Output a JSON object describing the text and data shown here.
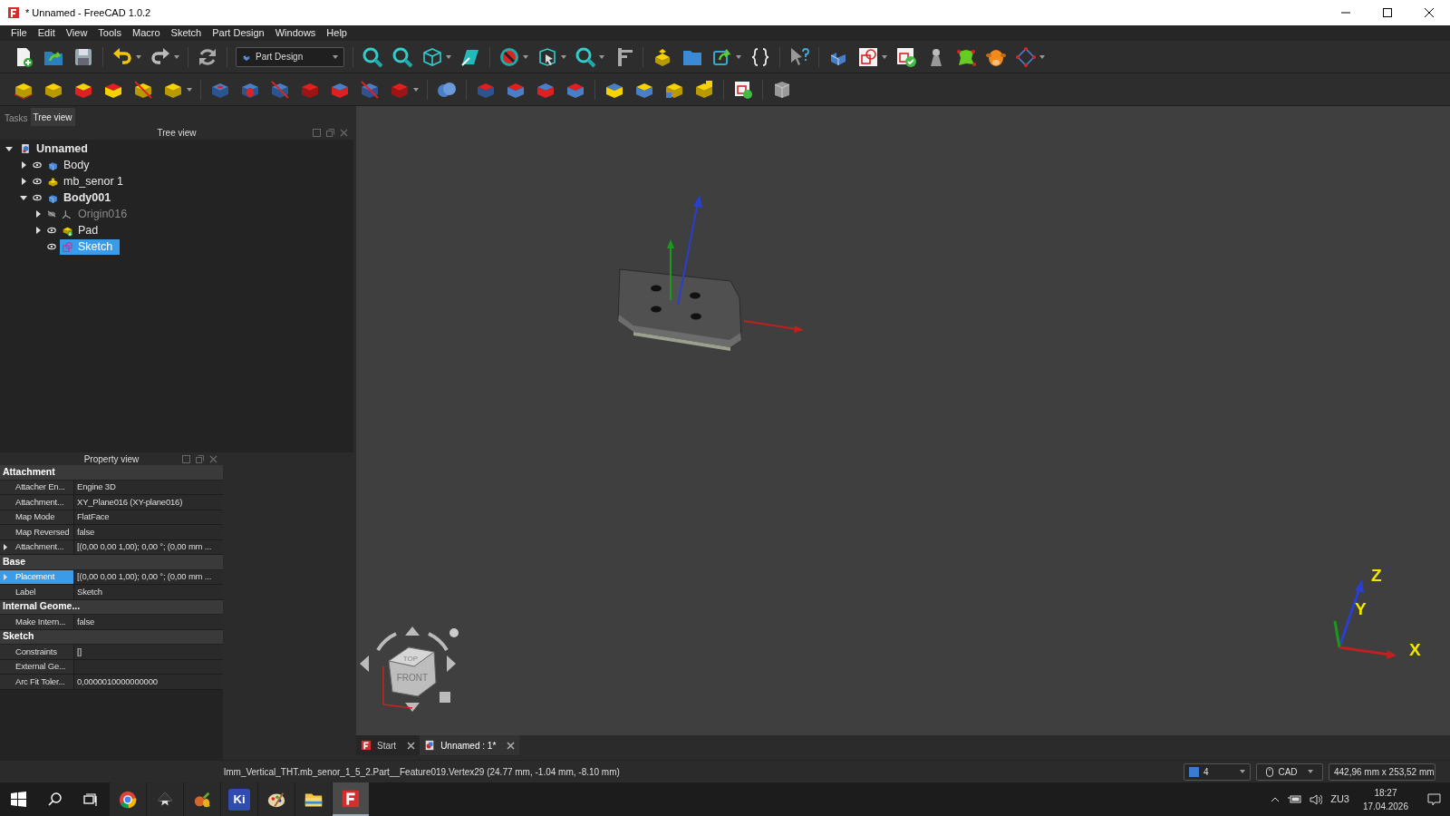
{
  "window": {
    "title": "* Unnamed - FreeCAD 1.0.2"
  },
  "menu": [
    "File",
    "Edit",
    "View",
    "Tools",
    "Macro",
    "Sketch",
    "Part Design",
    "Windows",
    "Help"
  ],
  "workbench": {
    "label": "Part Design"
  },
  "panel_tabs": [
    {
      "label": "Tasks",
      "selected": false
    },
    {
      "label": "Tree view",
      "selected": true
    }
  ],
  "tree": {
    "title": "Tree view",
    "items": [
      {
        "label": "Unnamed",
        "kind": "document",
        "active": true,
        "expanded": true,
        "selected": false,
        "children": [
          {
            "label": "Body",
            "kind": "body",
            "active": false,
            "expanded": false,
            "visible": true,
            "selected": false
          },
          {
            "label": "mb_senor 1",
            "kind": "part",
            "active": false,
            "expanded": false,
            "visible": true,
            "selected": false
          },
          {
            "label": "Body001",
            "kind": "body",
            "active": true,
            "expanded": true,
            "visible": true,
            "selected": false,
            "children": [
              {
                "label": "Origin016",
                "kind": "origin",
                "active": false,
                "expanded": false,
                "visible": false,
                "selected": false
              },
              {
                "label": "Pad",
                "kind": "pad",
                "active": false,
                "expanded": false,
                "visible": true,
                "selected": false
              },
              {
                "label": "Sketch",
                "kind": "sketch",
                "active": false,
                "visible": true,
                "selected": true
              }
            ]
          }
        ]
      }
    ]
  },
  "property_view": {
    "title": "Property view",
    "groups": [
      {
        "name": "Attachment",
        "rows": [
          {
            "name": "Attacher En...",
            "value": "Engine 3D",
            "selected": false
          },
          {
            "name": "Attachment...",
            "value": "XY_Plane016 (XY-plane016)",
            "selected": false
          },
          {
            "name": "Map Mode",
            "value": "FlatFace",
            "selected": false
          },
          {
            "name": "Map Reversed",
            "value": "false",
            "selected": false
          },
          {
            "name": "Attachment...",
            "value": "[(0,00 0,00 1,00); 0,00 °; (0,00 mm  ...",
            "expandable": true,
            "selected": false
          }
        ]
      },
      {
        "name": "Base",
        "rows": [
          {
            "name": "Placement",
            "value": "[(0,00 0,00 1,00); 0,00 °; (0,00 mm  ...",
            "expandable": true,
            "selected": true
          },
          {
            "name": "Label",
            "value": "Sketch",
            "selected": false
          }
        ]
      },
      {
        "name": "Internal Geome...",
        "rows": [
          {
            "name": "Make Intern...",
            "value": "false",
            "selected": false
          }
        ]
      },
      {
        "name": "Sketch",
        "rows": [
          {
            "name": "Constraints",
            "value": "[]",
            "selected": false
          },
          {
            "name": "External Ge...",
            "selected": false
          },
          {
            "name": "Arc Fit Toler...",
            "value": "0,0000010000000000",
            "selected": false
          }
        ]
      }
    ]
  },
  "navigation_cube": {
    "faces": [
      "TOP",
      "FRONT"
    ]
  },
  "axis_labels": [
    "Z",
    "Y",
    "X"
  ],
  "doc_tabs": [
    {
      "label": "Start",
      "kind": "start",
      "selected": false
    },
    {
      "label": "Unnamed : 1*",
      "kind": "document",
      "selected": true
    }
  ],
  "status_bar": {
    "message": "lmm_Vertical_THT.mb_senor_1_5_2.Part__Feature019.Vertex29 (24.77 mm, -1.04 mm, -8.10 mm)",
    "draw_style": "4",
    "navigation": "CAD",
    "dimensions": "442,96 mm x 253,52 mm"
  },
  "taskbar": {
    "apps": [
      {
        "kind": "chrome",
        "selected": false
      },
      {
        "kind": "inkscape",
        "selected": false
      },
      {
        "kind": "fruit",
        "selected": false
      },
      {
        "kind": "kicad",
        "label": "Ki",
        "selected": false
      },
      {
        "kind": "paint",
        "selected": false
      },
      {
        "kind": "explorer",
        "selected": false
      },
      {
        "kind": "freecad",
        "selected": true
      }
    ],
    "language": "ZU3",
    "time": "18:27",
    "date": "17.04.2026"
  }
}
